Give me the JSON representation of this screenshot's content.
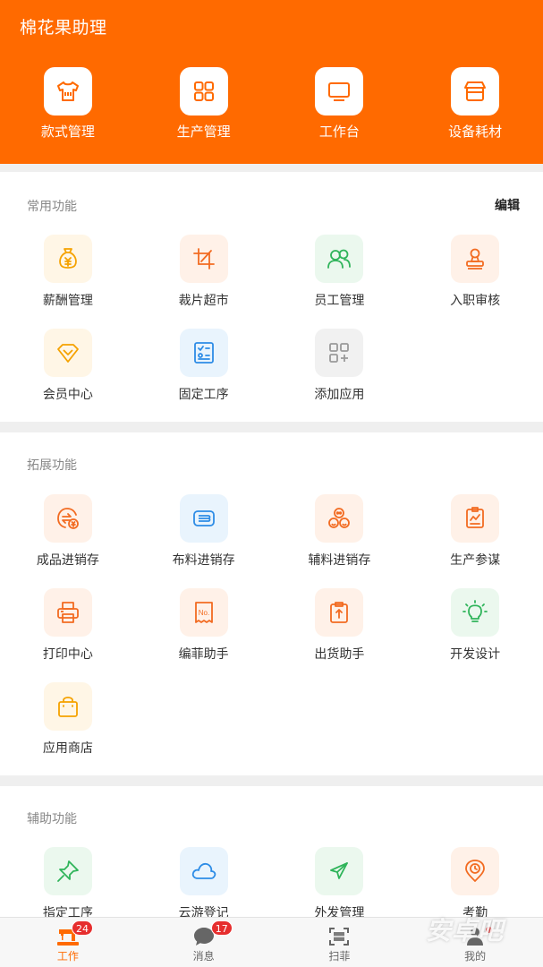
{
  "app": {
    "title": "棉花果助理"
  },
  "top_nav": [
    {
      "label": "款式管理",
      "icon": "shirt-icon"
    },
    {
      "label": "生产管理",
      "icon": "grid-icon"
    },
    {
      "label": "工作台",
      "icon": "monitor-icon"
    },
    {
      "label": "设备耗材",
      "icon": "store-icon"
    }
  ],
  "common": {
    "title": "常用功能",
    "edit_label": "编辑",
    "items": [
      {
        "label": "薪酬管理",
        "icon": "money-bag-icon"
      },
      {
        "label": "裁片超市",
        "icon": "crop-icon"
      },
      {
        "label": "员工管理",
        "icon": "users-icon"
      },
      {
        "label": "入职审核",
        "icon": "stamp-icon"
      },
      {
        "label": "会员中心",
        "icon": "diamond-icon"
      },
      {
        "label": "固定工序",
        "icon": "checklist-icon"
      },
      {
        "label": "添加应用",
        "icon": "add-app-icon"
      }
    ]
  },
  "extended": {
    "title": "拓展功能",
    "items": [
      {
        "label": "成品进销存",
        "icon": "exchange-icon"
      },
      {
        "label": "布料进销存",
        "icon": "fabric-icon"
      },
      {
        "label": "辅料进销存",
        "icon": "buttons-icon"
      },
      {
        "label": "生产参谋",
        "icon": "chart-board-icon"
      },
      {
        "label": "打印中心",
        "icon": "printer-icon"
      },
      {
        "label": "编菲助手",
        "icon": "ticket-icon",
        "icon_text": "No."
      },
      {
        "label": "出货助手",
        "icon": "clipboard-icon"
      },
      {
        "label": "开发设计",
        "icon": "lightbulb-icon"
      },
      {
        "label": "应用商店",
        "icon": "shopping-bag-icon"
      }
    ]
  },
  "auxiliary": {
    "title": "辅助功能",
    "items": [
      {
        "label": "指定工序",
        "icon": "pin-icon"
      },
      {
        "label": "云游登记",
        "icon": "cloud-icon"
      },
      {
        "label": "外发管理",
        "icon": "paper-plane-icon"
      },
      {
        "label": "考勤",
        "icon": "location-clock-icon"
      }
    ]
  },
  "tabbar": [
    {
      "label": "工作",
      "icon": "sewing-machine-icon",
      "badge": "24",
      "active": true
    },
    {
      "label": "消息",
      "icon": "chat-icon",
      "badge": "17"
    },
    {
      "label": "扫菲",
      "icon": "scan-icon"
    },
    {
      "label": "我的",
      "icon": "person-icon",
      "dot": true
    }
  ],
  "watermark": {
    "text": "安卓吧"
  },
  "colors": {
    "brand": "#ff6a00",
    "badge": "#e62e2e"
  }
}
